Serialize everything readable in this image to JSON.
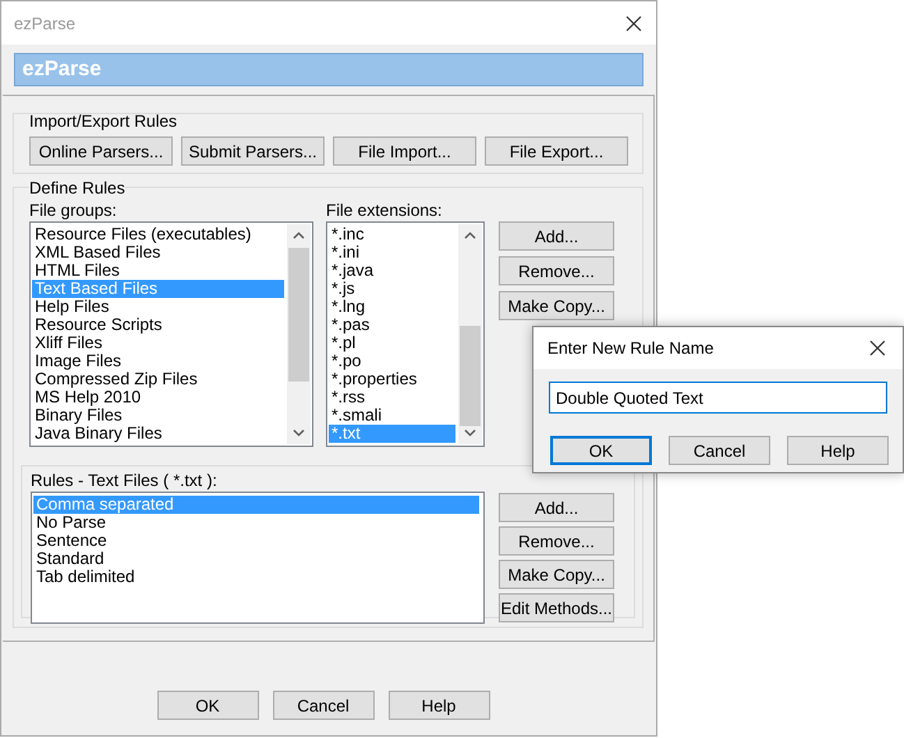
{
  "window": {
    "title": "ezParse",
    "banner": "ezParse"
  },
  "import_export": {
    "title": "Import/Export Rules",
    "buttons": [
      "Online Parsers...",
      "Submit Parsers...",
      "File Import...",
      "File Export..."
    ]
  },
  "define_rules": {
    "title": "Define Rules",
    "file_groups": {
      "label": "File groups:",
      "items": [
        {
          "label": "Resource Files (executables)",
          "selected": false
        },
        {
          "label": "XML Based Files",
          "selected": false
        },
        {
          "label": "HTML Files",
          "selected": false
        },
        {
          "label": "Text Based Files",
          "selected": true
        },
        {
          "label": "Help Files",
          "selected": false
        },
        {
          "label": "Resource Scripts",
          "selected": false
        },
        {
          "label": "Xliff Files",
          "selected": false
        },
        {
          "label": "Image Files",
          "selected": false
        },
        {
          "label": "Compressed Zip Files",
          "selected": false
        },
        {
          "label": "MS Help 2010",
          "selected": false
        },
        {
          "label": "Binary Files",
          "selected": false
        },
        {
          "label": "Java Binary Files",
          "selected": false
        }
      ]
    },
    "file_extensions": {
      "label": "File extensions:",
      "items": [
        {
          "label": "*.inc",
          "selected": false
        },
        {
          "label": "*.ini",
          "selected": false
        },
        {
          "label": "*.java",
          "selected": false
        },
        {
          "label": "*.js",
          "selected": false
        },
        {
          "label": "*.lng",
          "selected": false
        },
        {
          "label": "*.pas",
          "selected": false
        },
        {
          "label": "*.pl",
          "selected": false
        },
        {
          "label": "*.po",
          "selected": false
        },
        {
          "label": "*.properties",
          "selected": false
        },
        {
          "label": "*.rss",
          "selected": false
        },
        {
          "label": "*.smali",
          "selected": false
        },
        {
          "label": "*.txt",
          "selected": true
        }
      ]
    },
    "extension_buttons": [
      "Add...",
      "Remove...",
      "Make Copy..."
    ],
    "rules": {
      "label": "Rules - Text Files ( *.txt ):",
      "items": [
        {
          "label": "Comma separated",
          "selected": true
        },
        {
          "label": "No Parse",
          "selected": false
        },
        {
          "label": "Sentence",
          "selected": false
        },
        {
          "label": "Standard",
          "selected": false
        },
        {
          "label": "Tab delimited",
          "selected": false
        }
      ]
    },
    "rule_buttons": [
      "Add...",
      "Remove...",
      "Make Copy...",
      "Edit Methods..."
    ]
  },
  "buttons": [
    "OK",
    "Cancel",
    "Help"
  ],
  "dialog": {
    "title": "Enter New Rule Name",
    "value": "Double Quoted Text",
    "buttons": [
      {
        "label": "OK",
        "default": true
      },
      {
        "label": "Cancel",
        "default": false
      },
      {
        "label": "Help",
        "default": false
      }
    ]
  }
}
